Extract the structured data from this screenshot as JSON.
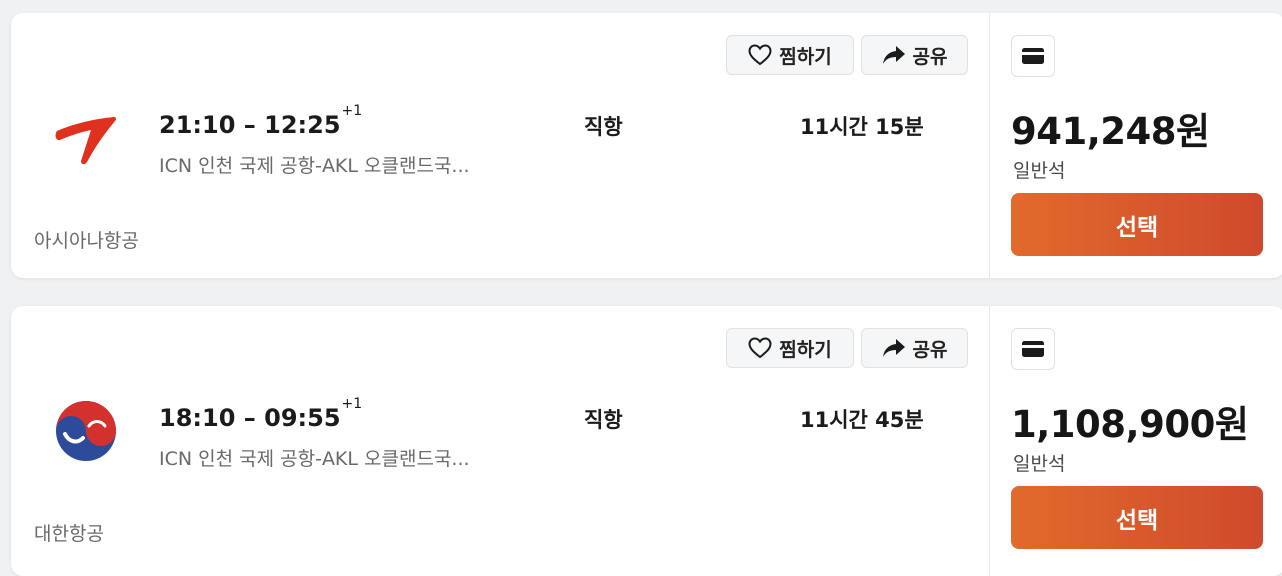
{
  "colors": {
    "accent_start": "#e26a2c",
    "accent_end": "#cf4a2c",
    "asiana_red": "#e0301e",
    "korean_red": "#d3312e",
    "korean_blue": "#2e4b9b"
  },
  "flights": [
    {
      "save_label": "찜하기",
      "share_label": "공유",
      "logo_icon": "asiana-airlines-logo",
      "depart_time": "21:10",
      "arrive_time": "12:25",
      "time_separator": "–",
      "day_offset": "+1",
      "route": "ICN 인천 국제 공항-AKL 오클랜드국...",
      "stops": "직항",
      "duration": "11시간 15분",
      "airline": "아시아나항공",
      "payment_icon": "credit-card-icon",
      "price": "941,248원",
      "cabin": "일반석",
      "select_label": "선택"
    },
    {
      "save_label": "찜하기",
      "share_label": "공유",
      "logo_icon": "korean-air-logo",
      "depart_time": "18:10",
      "arrive_time": "09:55",
      "time_separator": "–",
      "day_offset": "+1",
      "route": "ICN 인천 국제 공항-AKL 오클랜드국...",
      "stops": "직항",
      "duration": "11시간 45분",
      "airline": "대한항공",
      "payment_icon": "credit-card-icon",
      "price": "1,108,900원",
      "cabin": "일반석",
      "select_label": "선택"
    }
  ]
}
